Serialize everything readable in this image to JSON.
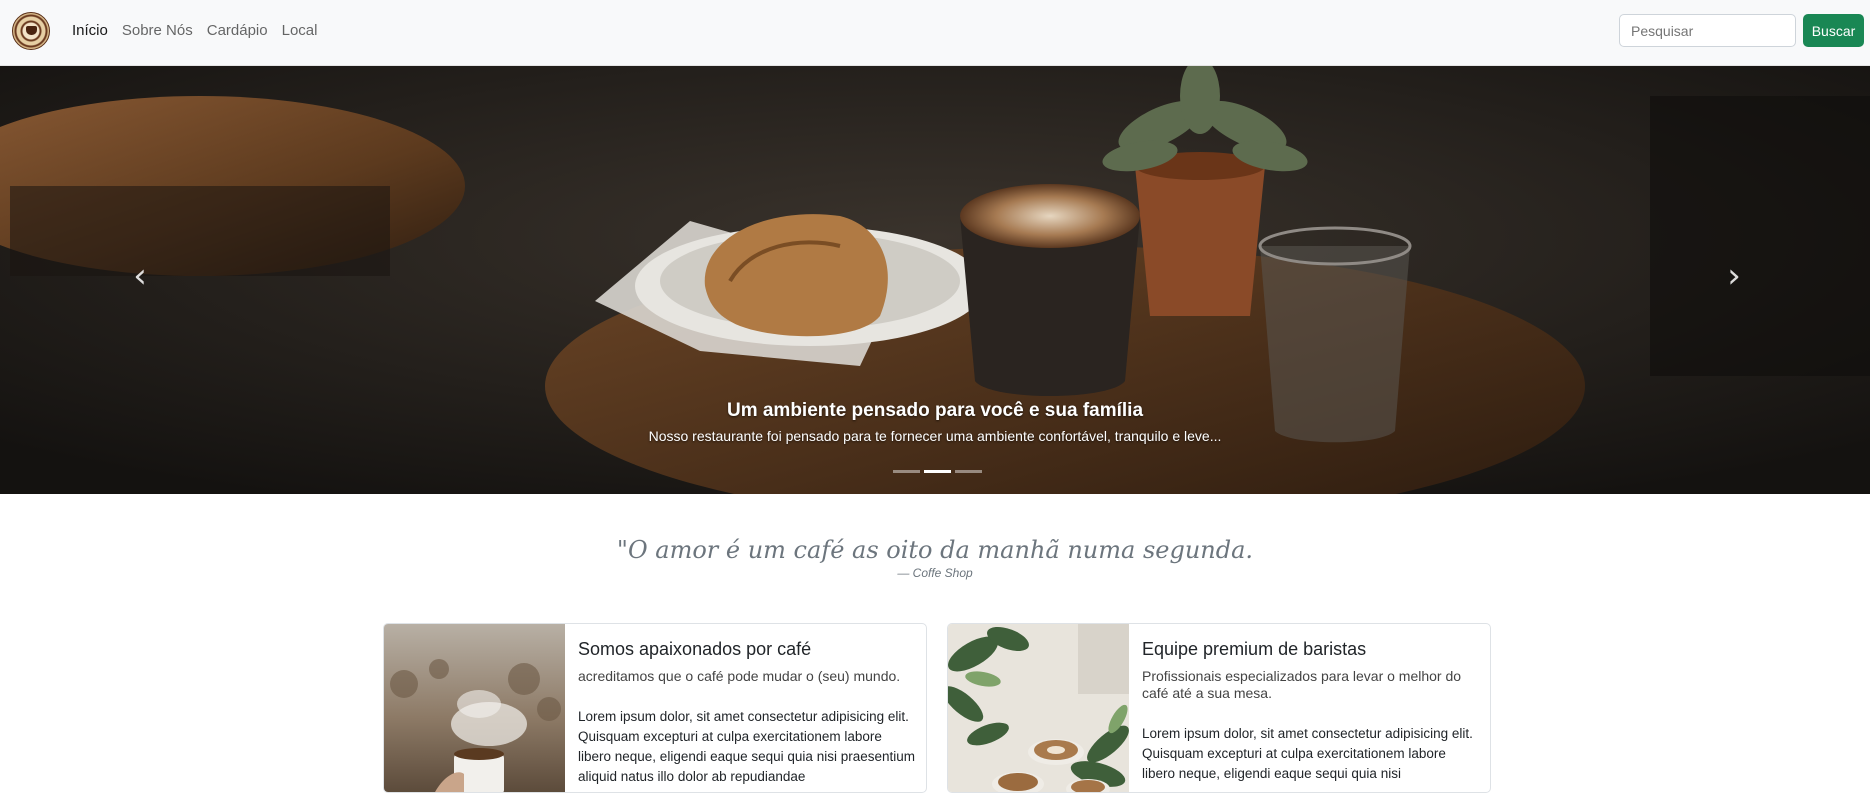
{
  "navbar": {
    "logo_alt": "Coffe Shop logo",
    "links": [
      "Início",
      "Sobre Nós",
      "Cardápio",
      "Local"
    ],
    "search_placeholder": "Pesquisar",
    "search_button": "Buscar"
  },
  "carousel": {
    "caption_title": "Um ambiente pensado para você e sua família",
    "caption_text": "Nosso restaurante foi pensado para te fornecer uma ambiente confortável, tranquilo e leve...",
    "prev_glyph": "‹",
    "next_glyph": "›",
    "active_slide": 2,
    "slide_count": 3
  },
  "quote": {
    "text": "\"O amor é um café as oito da manhã numa segunda.",
    "author": "—  Coffe Shop"
  },
  "cards": [
    {
      "title": "Somos apaixonados por café",
      "subtitle": "acreditamos que o café pode mudar o (seu) mundo.",
      "text": "Lorem ipsum dolor, sit amet consectetur adipisicing elit. Quisquam excepturi at culpa exercitationem labore libero neque, eligendi eaque sequi quia nisi praesentium aliquid natus illo dolor ab repudiandae"
    },
    {
      "title": "Equipe premium de baristas",
      "subtitle": "Profissionais especializados para levar o melhor do café até a sua mesa.",
      "text": "Lorem ipsum dolor, sit amet consectetur adipisicing elit. Quisquam excepturi at culpa exercitationem labore libero neque, eligendi eaque sequi quia nisi"
    }
  ],
  "colors": {
    "navbar_bg": "#f8f9fa",
    "button_green": "#198754",
    "carousel_dark": "#1d1a17"
  },
  "icons": {
    "prev": "chevron-left-icon",
    "next": "chevron-right-icon"
  }
}
